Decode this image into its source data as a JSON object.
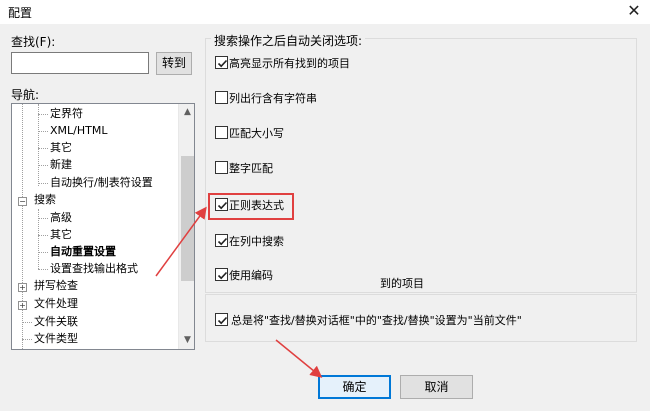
{
  "window": {
    "title": "配置",
    "close_glyph": "✕"
  },
  "find": {
    "label": "查找(F):",
    "value": "",
    "goto_label": "转到"
  },
  "nav": {
    "label": "导航:",
    "items": [
      {
        "text": "定界符"
      },
      {
        "text": "XML/HTML"
      },
      {
        "text": "其它"
      },
      {
        "text": "新建"
      },
      {
        "text": "自动换行/制表符设置"
      },
      {
        "text": "搜索",
        "expander": "−"
      },
      {
        "text": "高级"
      },
      {
        "text": "其它"
      },
      {
        "text": "自动重置设置"
      },
      {
        "text": "设置查找输出格式"
      },
      {
        "text": "拼写检查",
        "expander": "+"
      },
      {
        "text": "文件处理",
        "expander": "+"
      },
      {
        "text": "文件关联"
      },
      {
        "text": "文件类型"
      }
    ]
  },
  "options": {
    "group_title": "搜索操作之后自动关闭选项:",
    "items": [
      {
        "label": "高亮显示所有找到的项目",
        "checked": true
      },
      {
        "label": "列出行含有字符串",
        "checked": false
      },
      {
        "label": "匹配大小写",
        "checked": false
      },
      {
        "label": "整字匹配",
        "checked": false
      },
      {
        "label": "正则表达式",
        "checked": true
      },
      {
        "label": "在列中搜索",
        "checked": true
      },
      {
        "label": "使用编码",
        "checked": true
      }
    ],
    "partial_text": "到的项目",
    "global": {
      "label": "总是将\"查找/替换对话框\"中的\"查找/替换\"设置为\"当前文件\"",
      "checked": true
    }
  },
  "buttons": {
    "ok": "确定",
    "cancel": "取消"
  },
  "colors": {
    "annotation": "#e04040",
    "focus": "#0078d7"
  }
}
